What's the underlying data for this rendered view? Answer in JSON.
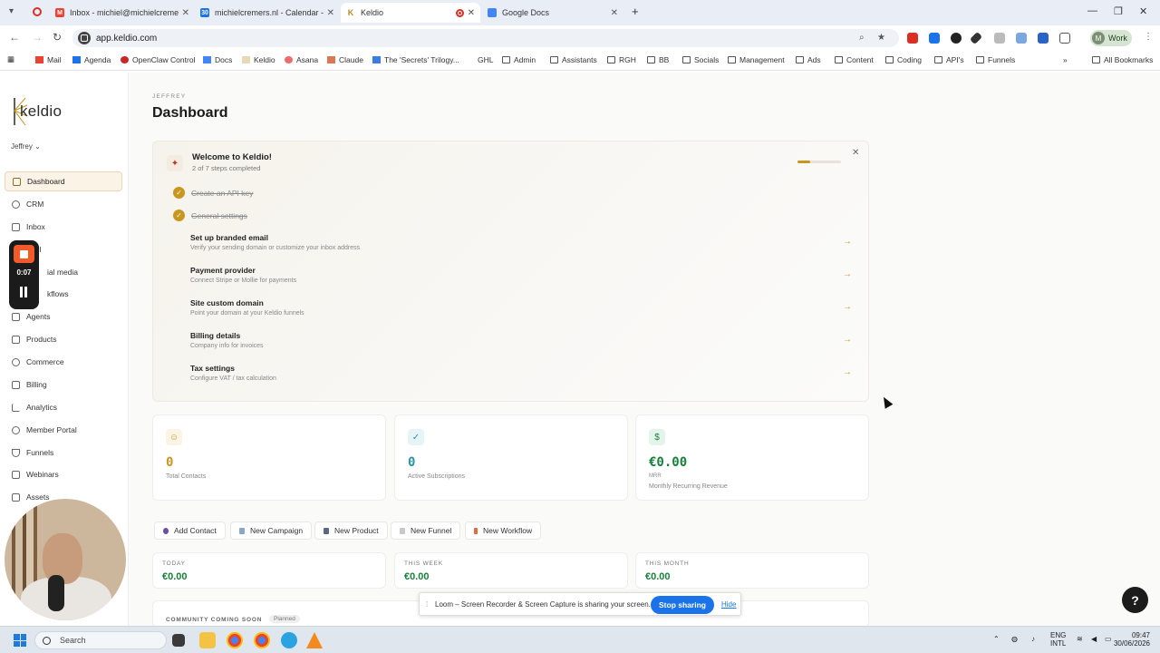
{
  "browser": {
    "tabs": [
      {
        "label": "Inbox - michiel@michielcremers",
        "favicon": "gmail-icon",
        "color": "#ea4335",
        "active": false
      },
      {
        "label": "michielcremers.nl - Calendar - W",
        "favicon": "calendar-icon",
        "color": "#1a73e8",
        "active": false
      },
      {
        "label": "Keldio",
        "favicon": "keldio-icon",
        "color": "#b58b2a",
        "active": true
      },
      {
        "label": "Google Docs",
        "favicon": "docs-icon",
        "color": "#4285f4",
        "active": false
      }
    ],
    "url": "app.keldio.com",
    "profile_initial": "M",
    "profile_label": "Work",
    "bookmarks": [
      "Mail",
      "Agenda",
      "OpenClaw Control",
      "Docs",
      "Keldio",
      "Asana",
      "Claude",
      "The 'Secrets' Trilogy...",
      "GHL",
      "Admin",
      "Assistants",
      "RGH",
      "BB",
      "Socials",
      "Management",
      "Ads",
      "Content",
      "Coding",
      "API's",
      "Funnels"
    ],
    "all_bookmarks": "All Bookmarks"
  },
  "sidebar": {
    "logo": "keldio",
    "workspace": "Jeffrey ⌄",
    "items": [
      {
        "label": "Dashboard",
        "icon": "grid-icon",
        "active": true
      },
      {
        "label": "CRM",
        "icon": "users-icon"
      },
      {
        "label": "Inbox",
        "icon": "inbox-icon"
      },
      {
        "label": "ail",
        "icon": "mail-icon"
      },
      {
        "label": "ial media",
        "icon": "share-icon"
      },
      {
        "label": "kflows",
        "icon": "workflow-icon"
      },
      {
        "label": "Agents",
        "icon": "agent-icon"
      },
      {
        "label": "Products",
        "icon": "box-icon"
      },
      {
        "label": "Commerce",
        "icon": "cart-icon"
      },
      {
        "label": "Billing",
        "icon": "receipt-icon"
      },
      {
        "label": "Analytics",
        "icon": "chart-icon"
      },
      {
        "label": "Member Portal",
        "icon": "portal-icon"
      },
      {
        "label": "Funnels",
        "icon": "funnel-icon"
      },
      {
        "label": "Webinars",
        "icon": "video-icon"
      },
      {
        "label": "Assets",
        "icon": "folder-icon"
      }
    ]
  },
  "recorder": {
    "time": "0:07"
  },
  "page": {
    "crumb": "JEFFREY",
    "title": "Dashboard"
  },
  "welcome": {
    "title": "Welcome to Keldio!",
    "subtitle": "2 of 7 steps completed",
    "progress": 0.286,
    "done_steps": [
      "Create an API key",
      "General settings"
    ],
    "steps": [
      {
        "title": "Set up branded email",
        "desc": "Verify your sending domain or customize your inbox address"
      },
      {
        "title": "Payment provider",
        "desc": "Connect Stripe or Mollie for payments"
      },
      {
        "title": "Site custom domain",
        "desc": "Point your domain at your Keldio funnels"
      },
      {
        "title": "Billing details",
        "desc": "Company info for invoices"
      },
      {
        "title": "Tax settings",
        "desc": "Configure VAT / tax calculation"
      }
    ]
  },
  "stats": [
    {
      "value": "0",
      "label": "Total Contacts",
      "label2": "",
      "color": "#c9971e",
      "icon": "users-icon"
    },
    {
      "value": "0",
      "label": "Active Subscriptions",
      "label2": "",
      "color": "#2a93a8",
      "icon": "check-icon"
    },
    {
      "value": "€0.00",
      "label": "MRR",
      "label2": "Monthly Recurring Revenue",
      "color": "#17803a",
      "icon": "dollar-icon"
    }
  ],
  "quick_actions": [
    "Add Contact",
    "New Campaign",
    "New Product",
    "New Funnel",
    "New Workflow"
  ],
  "periods": [
    {
      "label": "TODAY",
      "value": "€0.00"
    },
    {
      "label": "THIS WEEK",
      "value": "€0.00"
    },
    {
      "label": "THIS MONTH",
      "value": "€0.00"
    }
  ],
  "community": {
    "label": "COMMUNITY COMING SOON",
    "badge": "Planned"
  },
  "share_bar": {
    "message": "Loom – Screen Recorder & Screen Capture is sharing your screen.",
    "stop": "Stop sharing",
    "hide": "Hide"
  },
  "help": "?",
  "taskbar": {
    "search": "Search",
    "lang": "ENG",
    "lang2": "INTL",
    "time": "09:47",
    "date": "30/06/2026"
  }
}
